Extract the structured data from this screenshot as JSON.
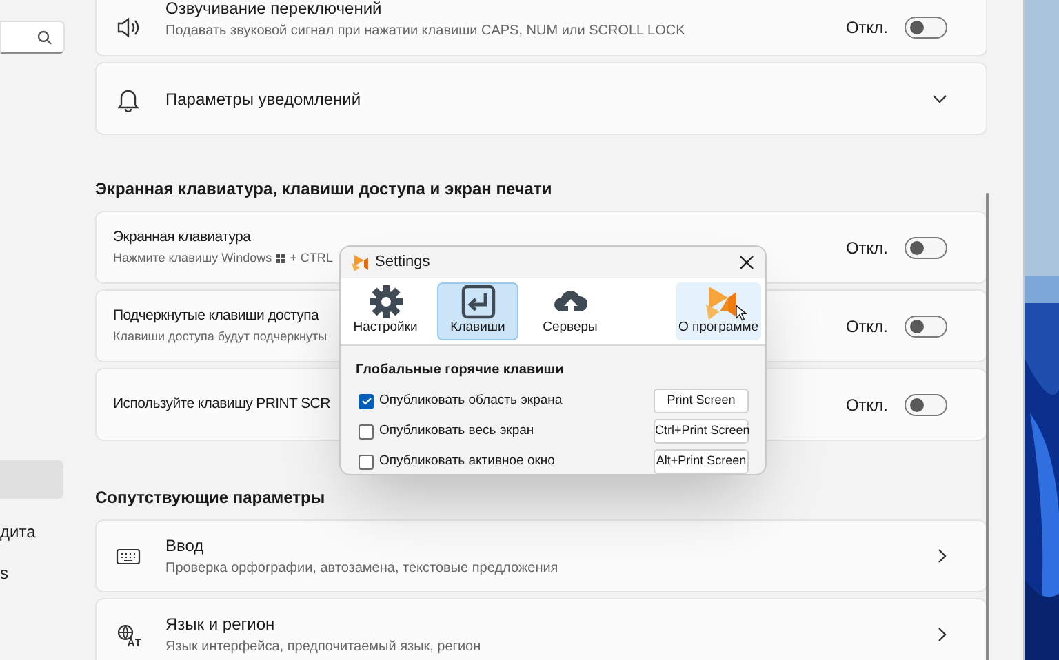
{
  "sidebar": {
    "items": [
      {
        "selected": true
      },
      {
        "label": "дита",
        "selected": false
      },
      {
        "label": "s",
        "selected": false
      }
    ]
  },
  "sections": [
    {
      "cards": [
        {
          "kind": "toggle",
          "title": "Озвучивание переключений",
          "subtitle": "Подавать звуковой сигнал при нажатии клавиши CAPS, NUM или SCROLL LOCK",
          "state": "Откл.",
          "on": false
        },
        {
          "kind": "expander",
          "title": "Параметры уведомлений",
          "expanded": false
        }
      ]
    },
    {
      "heading": "Экранная клавиатура, клавиши доступа и экран печати",
      "cards": [
        {
          "kind": "toggle",
          "title": "Экранная клавиатура",
          "subtitle": "Нажмите клавишу Windows",
          "subtitle_after": "+ CTRL",
          "state": "Откл.",
          "on": false
        },
        {
          "kind": "toggle",
          "title": "Подчеркнутые клавиши доступа",
          "subtitle": "Клавиши доступа будут подчеркнуты",
          "state": "Откл.",
          "on": false
        },
        {
          "kind": "toggle",
          "title": "Используйте клавишу PRINT SCR",
          "state": "Откл.",
          "on": false
        }
      ]
    },
    {
      "heading": "Сопутствующие параметры",
      "cards": [
        {
          "kind": "link",
          "title": "Ввод",
          "subtitle": "Проверка орфографии, автозамена, текстовые предложения"
        },
        {
          "kind": "link",
          "title": "Язык и регион",
          "subtitle": "Язык интерфейса, предпочитаемый язык, регион"
        }
      ]
    }
  ],
  "dialog": {
    "title": "Settings",
    "tabs": [
      {
        "label": "Настройки",
        "selected": false,
        "hover": false
      },
      {
        "label": "Клавиши",
        "selected": true,
        "hover": false
      },
      {
        "label": "Серверы",
        "selected": false,
        "hover": false
      },
      {
        "label": "О программе",
        "selected": false,
        "hover": true
      }
    ],
    "group": "Глобальные горячие клавиши",
    "hotkeys": [
      {
        "label": "Опубликовать область экрана",
        "checked": true,
        "key": "Print Screen"
      },
      {
        "label": "Опубликовать весь экран",
        "checked": false,
        "key": "Ctrl+Print Screen"
      },
      {
        "label": "Опубликовать активное окно",
        "checked": false,
        "key": "Alt+Print Screen"
      }
    ]
  }
}
